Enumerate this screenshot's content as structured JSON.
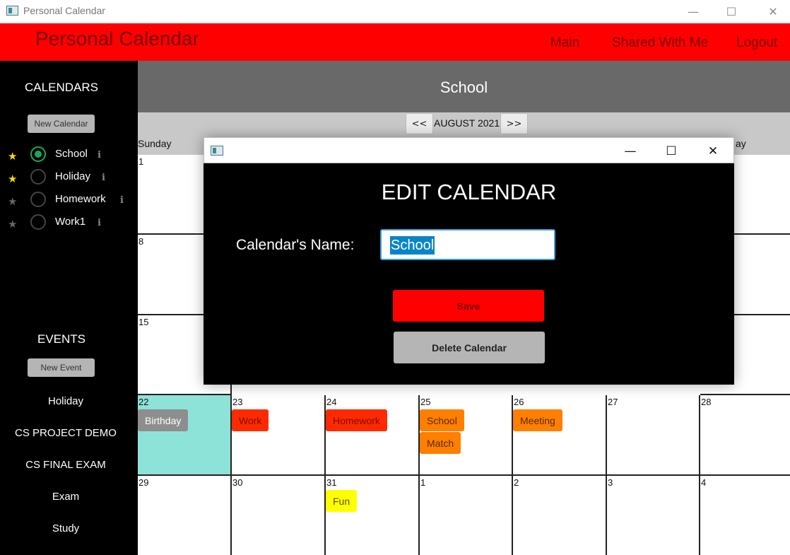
{
  "window": {
    "title": "Personal Calendar",
    "minimize_glyph": "—",
    "maximize_glyph": "☐",
    "close_glyph": "✕"
  },
  "header": {
    "brand": "Personal Calendar",
    "nav": [
      "Main",
      "Shared With Me",
      "Logout"
    ],
    "background": "#ff0000"
  },
  "sidebar": {
    "calendars_heading": "CALENDARS",
    "new_calendar_label": "New Calendar",
    "calendars": [
      {
        "name": "School",
        "selected": true,
        "favorite": true
      },
      {
        "name": "Holiday",
        "selected": false,
        "favorite": true
      },
      {
        "name": "Homework",
        "selected": false,
        "favorite": false
      },
      {
        "name": "Work1",
        "selected": false,
        "favorite": false
      }
    ],
    "star_glyph": "★",
    "info_glyph": "i",
    "events_heading": "EVENTS",
    "new_event_label": "New Event",
    "events": [
      "Holiday",
      "CS PROJECT DEMO",
      "CS FINAL EXAM",
      "Exam",
      "Study"
    ]
  },
  "main": {
    "calendar_title": "School",
    "prev_label": "<<",
    "next_label": ">>",
    "month_label": "AUGUST 2021",
    "day_headers": [
      "Sunday",
      "ay"
    ],
    "weeks": [
      [
        "1"
      ],
      [
        "8"
      ],
      [
        "15"
      ],
      [
        "22",
        "23",
        "24",
        "25",
        "26",
        "27",
        "28"
      ],
      [
        "29",
        "30",
        "31",
        "1",
        "2",
        "3",
        "4"
      ]
    ],
    "events": [
      {
        "label": "Birthday",
        "color": "#8e8e8e",
        "text_color": "#ffffff"
      },
      {
        "label": "Work",
        "color": "#ff2a00",
        "text_color": "#7a1000"
      },
      {
        "label": "Homework",
        "color": "#ff2a00",
        "text_color": "#7a1000"
      },
      {
        "label": "School",
        "color": "#ff7f00",
        "text_color": "#5a2a00"
      },
      {
        "label": "Match",
        "color": "#ff7f00",
        "text_color": "#5a2a00"
      },
      {
        "label": "Meeting",
        "color": "#ff7f00",
        "text_color": "#5a2a00"
      },
      {
        "label": "Fun",
        "color": "#ffff00",
        "text_color": "#555500"
      }
    ],
    "today_color": "#8ee3d9"
  },
  "dialog": {
    "heading": "EDIT CALENDAR",
    "name_label": "Calendar's Name:",
    "name_value": "School",
    "save_label": "Save",
    "delete_label": "Delete Calendar",
    "minimize_glyph": "—",
    "maximize_glyph": "☐",
    "close_glyph": "✕"
  }
}
